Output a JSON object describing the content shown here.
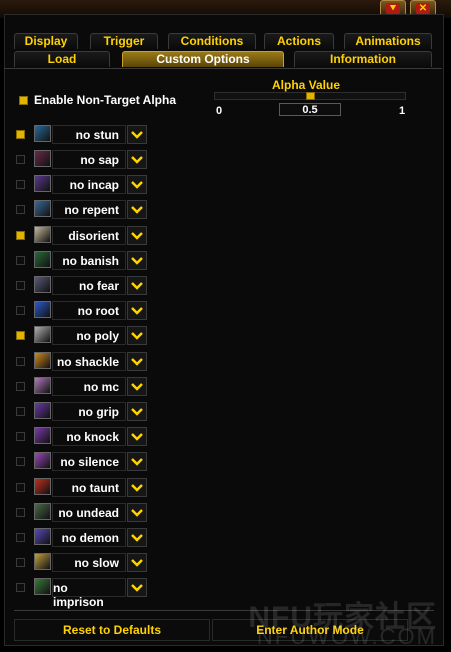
{
  "window": {
    "corner_buttons": [
      {
        "name": "collapse-button",
        "glyph": "⯆"
      },
      {
        "name": "close-button",
        "glyph": "✕"
      }
    ]
  },
  "tabs_row1": [
    {
      "label": "Display",
      "active": false
    },
    {
      "label": "Trigger",
      "active": false
    },
    {
      "label": "Conditions",
      "active": false
    },
    {
      "label": "Actions",
      "active": false
    },
    {
      "label": "Animations",
      "active": false
    }
  ],
  "tabs_row2": [
    {
      "label": "Load",
      "active": false
    },
    {
      "label": "Custom Options",
      "active": true
    },
    {
      "label": "Information",
      "active": false
    }
  ],
  "enable_non_target_alpha": {
    "label": "Enable Non-Target Alpha",
    "checked": true
  },
  "alpha": {
    "title": "Alpha Value",
    "min": "0",
    "max": "1",
    "value": "0.5",
    "fraction": 0.5
  },
  "options": [
    {
      "label": "no stun",
      "checked": true,
      "icon": "cyclone-icon",
      "color": "#2a6a9a"
    },
    {
      "label": "no sap",
      "checked": false,
      "icon": "sap-icon",
      "color": "#6a2a4a"
    },
    {
      "label": "no incap",
      "checked": false,
      "icon": "incapacitate-icon",
      "color": "#5a3a8a"
    },
    {
      "label": "no repent",
      "checked": false,
      "icon": "repentance-icon",
      "color": "#3a6a9a"
    },
    {
      "label": "disorient",
      "checked": true,
      "icon": "scroll-icon",
      "color": "#c8b89a"
    },
    {
      "label": "no banish",
      "checked": false,
      "icon": "banish-icon",
      "color": "#2a6a3a"
    },
    {
      "label": "no fear",
      "checked": false,
      "icon": "fear-icon",
      "color": "#5a5a7a"
    },
    {
      "label": "no root",
      "checked": false,
      "icon": "frost-nova-icon",
      "color": "#2a5acc"
    },
    {
      "label": "no poly",
      "checked": true,
      "icon": "polymorph-icon",
      "color": "#b0b0b0"
    },
    {
      "label": "no shackle",
      "checked": false,
      "icon": "shackle-icon",
      "color": "#d08a20"
    },
    {
      "label": "no mc",
      "checked": false,
      "icon": "mind-control-icon",
      "color": "#b07aba"
    },
    {
      "label": "no grip",
      "checked": false,
      "icon": "death-grip-icon",
      "color": "#6a3aaa"
    },
    {
      "label": "no knock",
      "checked": false,
      "icon": "knockback-icon",
      "color": "#7a3aaa"
    },
    {
      "label": "no silence",
      "checked": false,
      "icon": "silence-icon",
      "color": "#9a4aba"
    },
    {
      "label": "no taunt",
      "checked": false,
      "icon": "taunt-icon",
      "color": "#c03020"
    },
    {
      "label": "no undead",
      "checked": false,
      "icon": "undead-icon",
      "color": "#4a6a4a"
    },
    {
      "label": "no demon",
      "checked": false,
      "icon": "demon-icon",
      "color": "#5a4aba"
    },
    {
      "label": "no slow",
      "checked": false,
      "icon": "slow-icon",
      "color": "#c0a040"
    },
    {
      "label": "no imprison",
      "checked": false,
      "icon": "imprison-icon",
      "color": "#3a7a3a"
    }
  ],
  "footer": {
    "reset_label": "Reset to Defaults",
    "author_label": "Enter Author Mode"
  },
  "watermark": {
    "line1": "NFU玩家社区",
    "line2": "NFUWOW.COM"
  }
}
